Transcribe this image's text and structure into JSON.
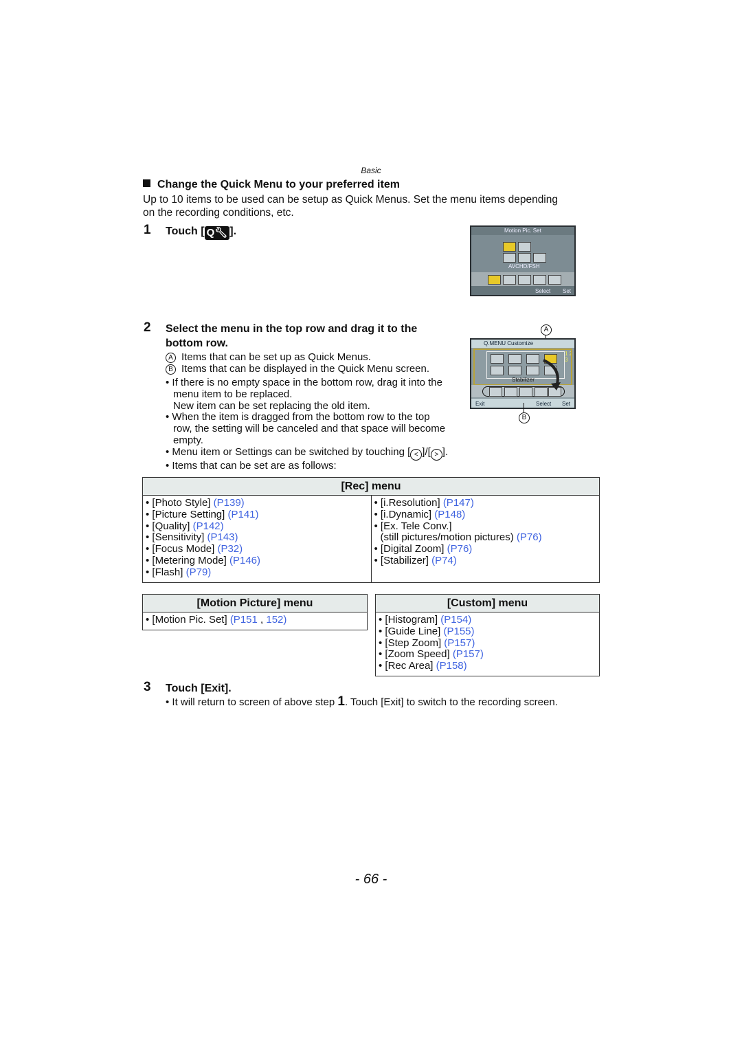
{
  "running_head": "Basic",
  "section_title": "Change the Quick Menu to your preferred item",
  "intro": [
    "Up to 10 items to be used can be setup as Quick Menus. Set the menu items depending",
    "on the recording conditions, etc."
  ],
  "step1": {
    "number": "1",
    "title_before": "Touch [",
    "icon_label": "Q",
    "title_after": "]."
  },
  "step2": {
    "number": "2",
    "title": [
      "Select the menu in the top row and drag it to the",
      "bottom row."
    ],
    "legend": [
      {
        "mark": "A",
        "text": "Items that can be set up as Quick Menus."
      },
      {
        "mark": "B",
        "text": "Items that can be displayed in the Quick Menu screen."
      }
    ],
    "bullets": [
      [
        "If there is no empty space in the bottom row, drag it into the",
        "menu item to be replaced.",
        "New item can be set replacing the old item."
      ],
      [
        "When the item is dragged from the bottom row to the top",
        "row, the setting will be canceled and that space will become",
        "empty."
      ]
    ],
    "switch_text": "Menu item or Settings can be switched by touching [",
    "switch_mid": "]/[",
    "switch_end": "].",
    "last_bullet": "Items that can be set are as follows:"
  },
  "screen1": {
    "title": "Motion Pic. Set",
    "caption": "AVCHD/FSH",
    "select": "Select",
    "set": "Set"
  },
  "screen2": {
    "title": "Q.MENU Customize",
    "pages": "1 2 3",
    "caption": "Stabilizer",
    "exit": "Exit",
    "select": "Select",
    "set": "Set",
    "callout_a": "A",
    "callout_b": "B"
  },
  "link_color": "#3f63e0",
  "tables": {
    "rec": {
      "header": "[Rec] menu",
      "left": [
        {
          "t": "[Photo Style]",
          "l": "(P139)"
        },
        {
          "t": "[Picture Setting]",
          "l": "(P141)"
        },
        {
          "t": "[Quality]",
          "l": "(P142)"
        },
        {
          "t": "[Sensitivity]",
          "l": "(P143)"
        },
        {
          "t": "[Focus Mode]",
          "l": "(P32)"
        },
        {
          "t": "[Metering Mode]",
          "l": "(P146)"
        },
        {
          "t": "[Flash]",
          "l": "(P79)"
        }
      ],
      "right": [
        {
          "t": "[i.Resolution]",
          "l": "(P147)"
        },
        {
          "t": "[i.Dynamic]",
          "l": "(P148)"
        },
        {
          "t": "[Ex. Tele Conv.]",
          "l": ""
        },
        {
          "t": "(still pictures/motion pictures)",
          "l": "(P76)",
          "cont": true
        },
        {
          "t": "[Digital Zoom]",
          "l": "(P76)"
        },
        {
          "t": "[Stabilizer]",
          "l": "(P74)"
        }
      ]
    },
    "motion": {
      "header": "[Motion Picture] menu",
      "items": [
        {
          "t": "[Motion Pic. Set]",
          "l": "(P151",
          "sep": " , ",
          "l2": "152)"
        }
      ]
    },
    "custom": {
      "header": "[Custom] menu",
      "items": [
        {
          "t": "[Histogram]",
          "l": "(P154)"
        },
        {
          "t": "[Guide Line]",
          "l": "(P155)"
        },
        {
          "t": "[Step Zoom]",
          "l": "(P157)"
        },
        {
          "t": "[Zoom Speed]",
          "l": "(P157)"
        },
        {
          "t": "[Rec Area]",
          "l": "(P158)"
        }
      ]
    }
  },
  "step3": {
    "number": "3",
    "title": "Touch [Exit].",
    "bullet_before": "It will return to screen of above step ",
    "bullet_step": "1",
    "bullet_after": ". Touch [Exit] to switch to the recording screen."
  },
  "page_number": "- 66 -"
}
